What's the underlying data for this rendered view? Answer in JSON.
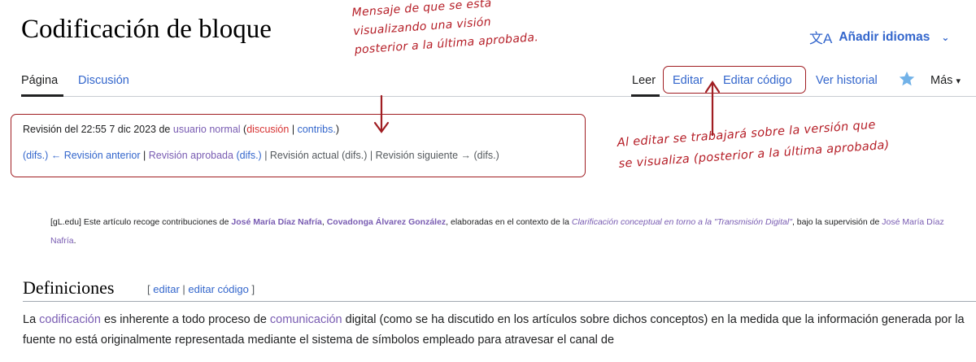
{
  "header": {
    "title": "Codificación de bloque",
    "language_button": {
      "icon": "translate-icon",
      "label": "Añadir idiomas",
      "chevron": "⌄"
    }
  },
  "tabs": {
    "left": [
      {
        "label": "Página"
      },
      {
        "label": "Discusión"
      }
    ],
    "right": [
      {
        "label": "Leer"
      },
      {
        "label": "Editar"
      },
      {
        "label": "Editar código"
      },
      {
        "label": "Ver historial"
      },
      {
        "label": "Más"
      }
    ],
    "star_icon": "star-icon"
  },
  "annotations": {
    "top_note": [
      "Mensaje de que se está",
      "visualizando una visión",
      "posterior a la última aprobada."
    ],
    "right_note": [
      "Al editar se trabajará sobre la versión que",
      "se visualiza (posterior a la última aprobada)"
    ]
  },
  "revision": {
    "prefix": "Revisión del 22:55 7 dic 2023 de",
    "user": "usuario normal",
    "open_paren": "(",
    "talk": "discusión",
    "sep": "|",
    "contribs": "contribs.",
    "close_paren": ")",
    "diffs": "(difs.)",
    "prev": "← Revisión anterior",
    "approved": "Revisión aprobada",
    "approved_diffs": "(difs.)",
    "current": "| Revisión actual (difs.) | Revisión siguiente → (difs.)"
  },
  "note": {
    "prefix": "[gL.edu] Este artículo recoge contribuciones de",
    "author1": "José María Díaz Nafría",
    "comma": ",",
    "author2": "Covadonga Álvarez González",
    "mid": ", elaboradas en el contexto de la",
    "context": "Clarificación conceptual en torno a la \"Transmisión Digital\"",
    "supervision": ", bajo la supervisión de",
    "supervisor": "José María Díaz Nafría",
    "end": "."
  },
  "section": {
    "title": "Definiciones",
    "edit_open": "[",
    "edit": "editar",
    "edit_sep": "|",
    "edit_code": "editar código",
    "edit_close": "]"
  },
  "body": {
    "t1": "La",
    "link1": "codificación",
    "t2": "es inherente a todo proceso de",
    "link2": "comunicación",
    "t3": "digital (como se ha discutido en los artículos sobre dichos conceptos) en la medida que la información generada por la fuente no está originalmente representada mediante el sistema de símbolos empleado para atravesar el canal de"
  },
  "colors": {
    "link": "#3366cc",
    "visited": "#795cb2",
    "redlink": "#d73333",
    "annotation": "#a01d22",
    "star": "#72b2e8"
  }
}
